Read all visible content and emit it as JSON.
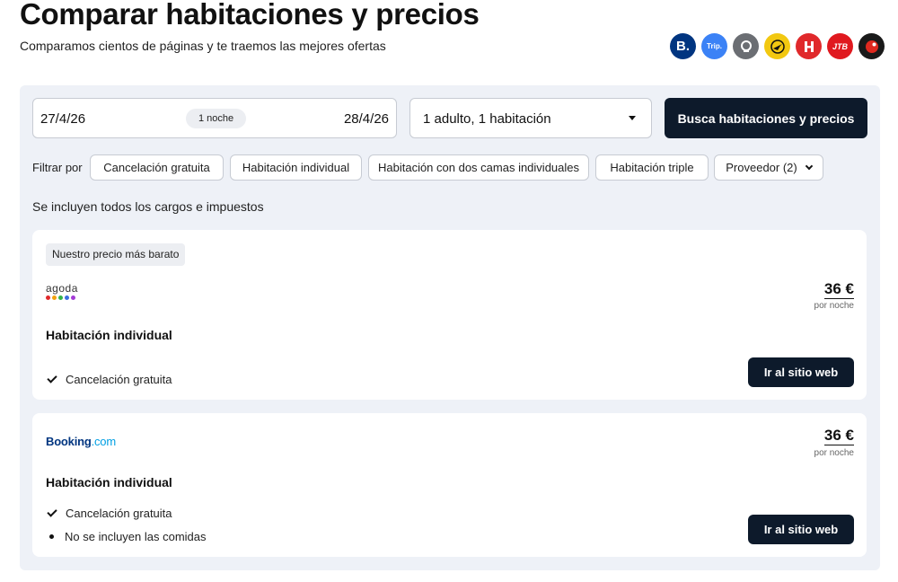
{
  "header": {
    "title": "Comparar habitaciones y precios",
    "subtitle": "Comparamos cientos de páginas y te traemos las mejores ofertas"
  },
  "providers": [
    {
      "name": "booking-logo-icon",
      "label": "B.",
      "color": "#003580"
    },
    {
      "name": "trip-logo-icon",
      "label": "Trip.",
      "color": "#3b82f6"
    },
    {
      "name": "agoda-search-icon",
      "label": "",
      "color": "#6b6e73"
    },
    {
      "name": "plane-logo-icon",
      "label": "",
      "color": "#f2c811"
    },
    {
      "name": "hotel-h-logo-icon",
      "label": "",
      "color": "#e0292b"
    },
    {
      "name": "jtb-logo-icon",
      "label": "JTB",
      "color": "#e0191f"
    },
    {
      "name": "red-dot-logo-icon",
      "label": "",
      "color": "#1a1a1a"
    }
  ],
  "search": {
    "checkin": "27/4/26",
    "nights": "1 noche",
    "checkout": "28/4/26",
    "guests": "1 adulto, 1 habitación",
    "button": "Busca habitaciones y precios"
  },
  "filters": {
    "label": "Filtrar por",
    "chips": [
      "Cancelación gratuita",
      "Habitación individual",
      "Habitación con dos camas individuales",
      "Habitación triple",
      "Proveedor (2)"
    ]
  },
  "taxes_note": "Se incluyen todos los cargos e impuestos",
  "offers": [
    {
      "badge": "Nuestro precio más barato",
      "provider": "agoda",
      "price": "36 €",
      "per_night": "por noche",
      "room": "Habitación individual",
      "features": [
        "Cancelación gratuita"
      ],
      "button": "Ir al sitio web"
    },
    {
      "provider_main": "Booking",
      "provider_suffix": ".com",
      "price": "36 €",
      "per_night": "por noche",
      "room": "Habitación individual",
      "features": [
        "Cancelación gratuita",
        "No se incluyen las comidas"
      ],
      "button": "Ir al sitio web"
    }
  ],
  "colors": {
    "accent_dark": "#0d1a2b",
    "panel_bg": "#eef1f7",
    "agoda_dots": [
      "#e0292b",
      "#f2a20f",
      "#33b34a",
      "#3b6fe0",
      "#a43bd6"
    ]
  }
}
